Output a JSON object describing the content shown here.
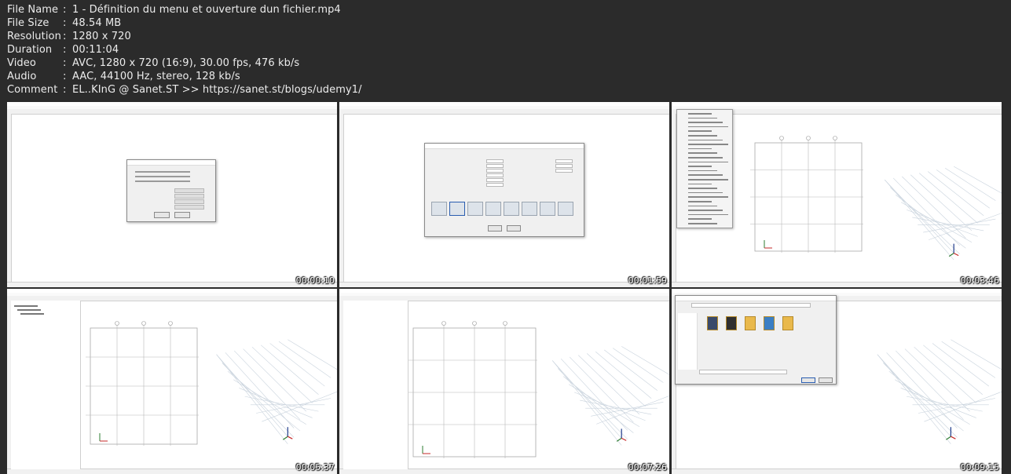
{
  "file_info": [
    {
      "key": "File Name",
      "value": "1 - Définition du menu et ouverture dun fichier.mp4"
    },
    {
      "key": "File Size",
      "value": "48.54 MB"
    },
    {
      "key": "Resolution",
      "value": "1280 x 720"
    },
    {
      "key": "Duration",
      "value": "00:11:04"
    },
    {
      "key": "Video",
      "value": "AVC, 1280 x 720 (16:9), 30.00 fps, 476 kb/s"
    },
    {
      "key": "Audio",
      "value": "AAC, 44100 Hz, stereo, 128 kb/s"
    },
    {
      "key": "Comment",
      "value": "EL..KInG @ Sanet.ST >> https://sanet.st/blogs/udemy1/"
    }
  ],
  "separator": ":",
  "thumbnails": [
    {
      "timestamp": "00:00:10",
      "scene": "model-initialization-dialog"
    },
    {
      "timestamp": "00:01:59",
      "scene": "new-model-quick-templates-dialog"
    },
    {
      "timestamp": "00:03:46",
      "scene": "file-menu-open"
    },
    {
      "timestamp": "00:05:37",
      "scene": "model-explorer-plan-3d"
    },
    {
      "timestamp": "00:07:26",
      "scene": "plan-and-3d-view"
    },
    {
      "timestamp": "00:09:15",
      "scene": "open-file-dialog"
    }
  ],
  "colors": {
    "background": "#2b2b2b",
    "text": "#ececec",
    "timestamp": "#ffffff"
  }
}
